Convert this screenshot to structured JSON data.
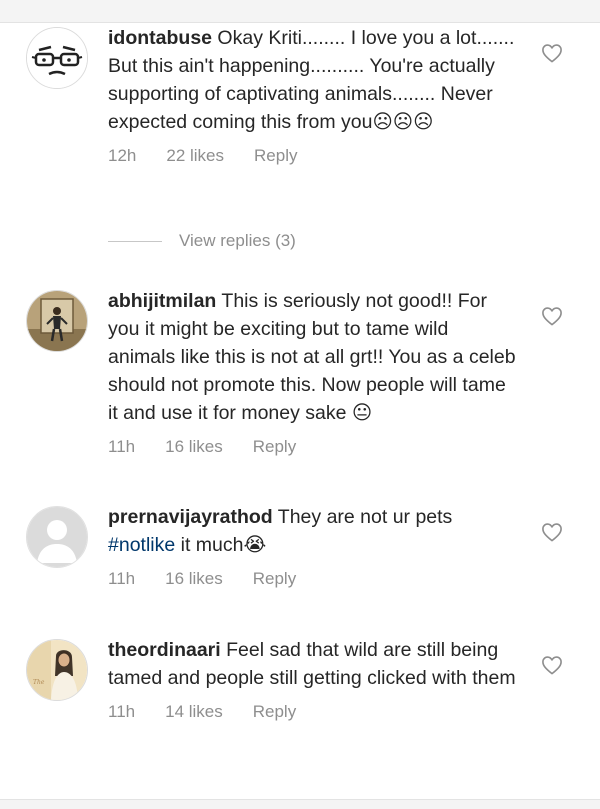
{
  "comments": [
    {
      "username": "idontabuse",
      "text": " Okay Kriti........ I love you a lot....... But this ain't happening.......... You're actually supporting of captivating animals........ Never expected coming this from you",
      "emoji": "☹☹☹",
      "time": "12h",
      "likes": "22 likes",
      "reply": "Reply"
    },
    {
      "username": "abhijitmilan",
      "text": " This is seriously not good!! For you it might be exciting but to tame wild animals like this is not at all grt!! You as a celeb should not promote this. Now people will tame it and use it for money sake ",
      "emoji": "😐",
      "time": "11h",
      "likes": "16 likes",
      "reply": "Reply"
    },
    {
      "username": "prernavijayrathod",
      "text_before": " They are not ur pets ",
      "hashtag": "#notlike",
      "text_after": " it much",
      "emoji": "😭",
      "time": "11h",
      "likes": "16 likes",
      "reply": "Reply"
    },
    {
      "username": "theordinaari",
      "text": " Feel sad that wild are still being tamed and people still getting clicked with them",
      "time": "11h",
      "likes": "14 likes",
      "reply": "Reply"
    }
  ],
  "view_replies": "View replies (3)",
  "icons": {
    "heart": "heart-outline-icon",
    "default_avatar": "default-avatar-icon"
  },
  "colors": {
    "text": "#262626",
    "meta": "#8e8e8e",
    "hashtag": "#00376b",
    "border": "#dbdbdb"
  }
}
